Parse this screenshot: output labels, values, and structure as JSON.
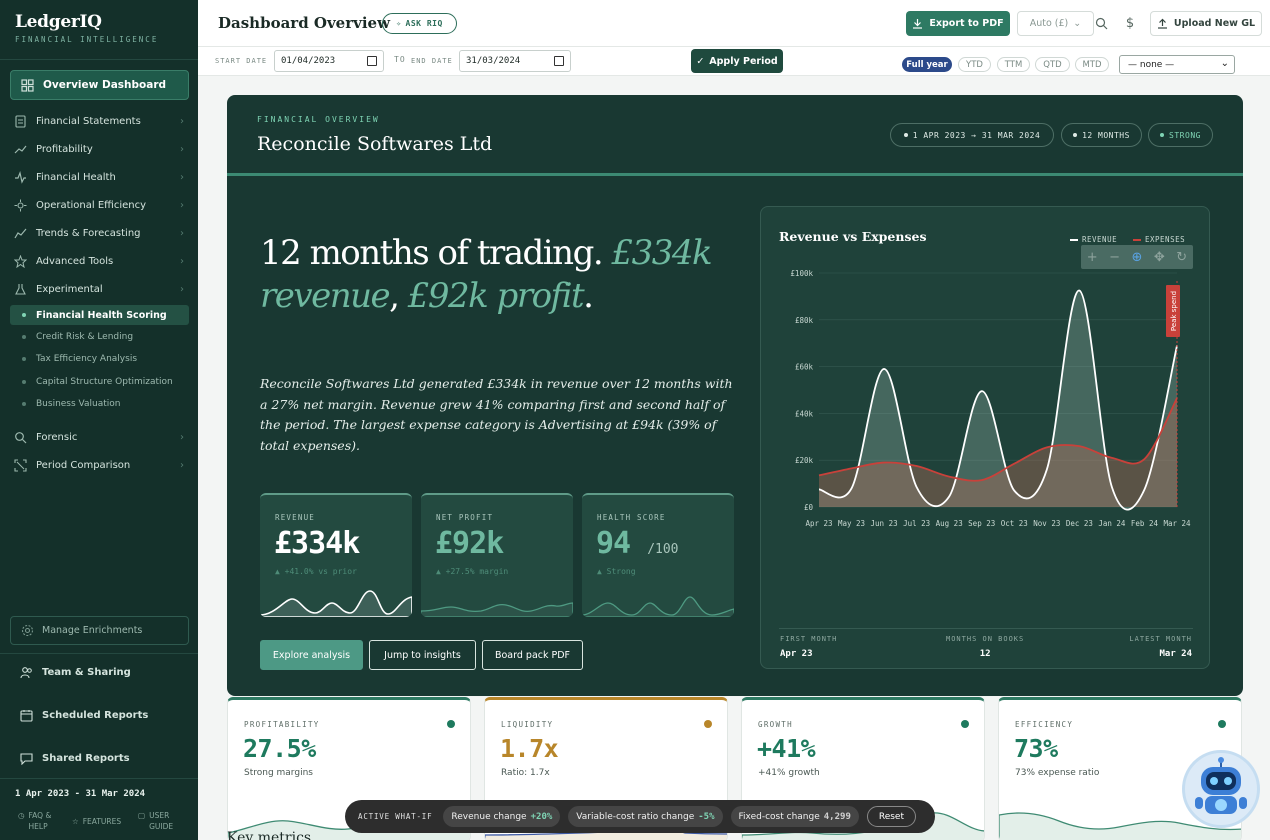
{
  "brand": {
    "title": "LedgerIQ",
    "subtitle": "FINANCIAL INTELLIGENCE"
  },
  "sidebar": {
    "active": "Overview Dashboard",
    "items": [
      {
        "label": "Financial Statements",
        "icon": "document-icon"
      },
      {
        "label": "Profitability",
        "icon": "trend-up-icon"
      },
      {
        "label": "Financial Health",
        "icon": "pulse-icon"
      },
      {
        "label": "Operational Efficiency",
        "icon": "gauge-icon"
      },
      {
        "label": "Trends & Forecasting",
        "icon": "chart-line-icon"
      },
      {
        "label": "Advanced Tools",
        "icon": "star-icon"
      },
      {
        "label": "Experimental",
        "icon": "flask-icon"
      }
    ],
    "sub_active": "Financial Health Scoring",
    "sub_items": [
      "Credit Risk & Lending",
      "Tax Efficiency Analysis",
      "Capital Structure Optimization",
      "Business Valuation"
    ],
    "items2": [
      {
        "label": "Forensic",
        "icon": "magnifier-icon"
      },
      {
        "label": "Period Comparison",
        "icon": "compare-icon"
      }
    ],
    "enrich": "Manage Enrichments",
    "bottom": [
      "Team & Sharing",
      "Scheduled Reports",
      "Shared Reports"
    ],
    "period": "1 Apr 2023 - 31 Mar 2024",
    "footer": {
      "faq": "FAQ &\nHELP",
      "features": "FEATURES",
      "guide": "USER\nGUIDE"
    }
  },
  "topbar": {
    "title": "Dashboard Overview",
    "ask": "ASK RIQ",
    "export": "Export to PDF",
    "currency": "Auto (£)",
    "upload": "Upload New GL"
  },
  "datebar": {
    "start_label": "START DATE",
    "start": "01/04/2023",
    "to_label": "TO",
    "end_label": "END DATE",
    "end": "31/03/2024",
    "apply": "Apply Period",
    "periods": [
      "Full year",
      "YTD",
      "TTM",
      "QTD",
      "MTD"
    ],
    "select": "— none —"
  },
  "hero": {
    "eyebrow": "FINANCIAL OVERVIEW",
    "company": "Reconcile Softwares Ltd",
    "tags": [
      "1 APR 2023 → 31 MAR 2024",
      "12 MONTHS",
      "STRONG"
    ],
    "headline_a": "12 months of trading. ",
    "headline_b": "£334k revenue",
    "headline_c": ", ",
    "headline_d": "£92k profit",
    "headline_e": ".",
    "summary": "Reconcile Softwares Ltd generated £334k in revenue over 12 months with a 27% net margin. Revenue grew 41% comparing first and second half of the period. The largest expense category is Advertising at £94k (39% of total expenses).",
    "kpis": [
      {
        "label": "REVENUE",
        "value": "£334k",
        "note": "▲ +41.0% vs prior"
      },
      {
        "label": "NET PROFIT",
        "value": "£92k",
        "note": "▲ +27.5% margin"
      },
      {
        "label": "HEALTH SCORE",
        "value": "94",
        "unit": "/100",
        "note": "▲ Strong"
      }
    ],
    "buttons": [
      "Explore analysis",
      "Jump to insights",
      "Board pack PDF"
    ]
  },
  "chart_data": {
    "type": "area",
    "title": "Revenue vs Expenses",
    "categories": [
      "Apr 23",
      "May 23",
      "Jun 23",
      "Jul 23",
      "Aug 23",
      "Sep 23",
      "Oct 23",
      "Nov 23",
      "Dec 23",
      "Jan 24",
      "Feb 24",
      "Mar 24"
    ],
    "series": [
      {
        "name": "REVENUE",
        "color": "#ffffff",
        "values": [
          7500,
          8000,
          59000,
          8500,
          4500,
          49500,
          7000,
          16000,
          92500,
          8500,
          7500,
          69000
        ]
      },
      {
        "name": "EXPENSES",
        "color": "#c9413a",
        "values": [
          13500,
          16500,
          19000,
          17500,
          13000,
          11500,
          18500,
          25500,
          26000,
          21000,
          20500,
          46500
        ]
      }
    ],
    "yticks": [
      "£0",
      "£20k",
      "£40k",
      "£60k",
      "£80k",
      "£100k"
    ],
    "ylim": [
      0,
      100000
    ],
    "annotation": "Peak spend",
    "footer": [
      {
        "label": "FIRST MONTH",
        "value": "Apr 23"
      },
      {
        "label": "MONTHS ON BOOKS",
        "value": "12"
      },
      {
        "label": "LATEST MONTH",
        "value": "Mar 24"
      }
    ]
  },
  "metrics": [
    {
      "label": "PROFITABILITY",
      "value": "27.5%",
      "sub": "Strong margins",
      "color": "#1e7a5e"
    },
    {
      "label": "LIQUIDITY",
      "value": "1.7x",
      "sub": "Ratio: 1.7x",
      "color": "#b8862a"
    },
    {
      "label": "GROWTH",
      "value": "+41%",
      "sub": "+41% growth",
      "color": "#1e7a5e"
    },
    {
      "label": "EFFICIENCY",
      "value": "73%",
      "sub": "73% expense ratio",
      "color": "#1e7a5e"
    }
  ],
  "whatif": {
    "label": "ACTIVE WHAT-IF",
    "chips": [
      {
        "label": "Revenue change",
        "value": "+20%"
      },
      {
        "label": "Variable-cost ratio change",
        "value": "-5%"
      },
      {
        "label": "Fixed-cost change",
        "value": "4,299"
      }
    ],
    "reset": "Reset"
  },
  "partial_heading": "Key metrics"
}
